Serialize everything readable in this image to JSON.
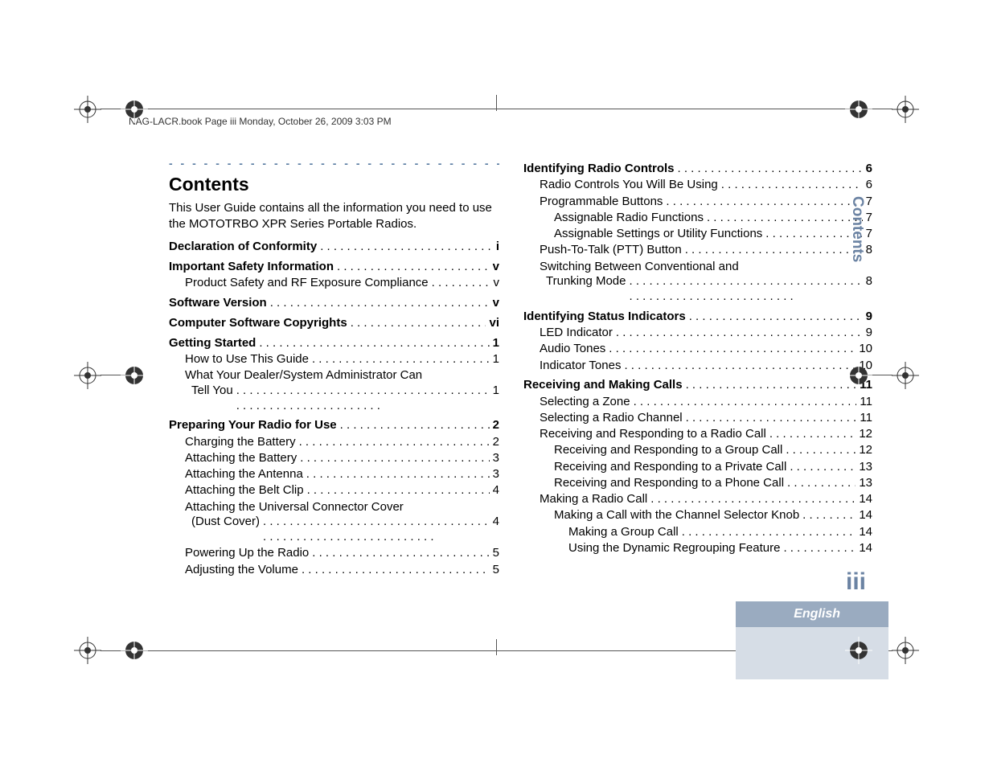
{
  "header_line": "NAG-LACR.book  Page iii  Monday, October 26, 2009  3:03 PM",
  "title": "Contents",
  "intro": "This User Guide contains all the information you need to use the MOTOTRBO XPR Series Portable Radios.",
  "sidebar_tab": "Contents",
  "page_number": "iii",
  "language_tab": "English",
  "left_toc": [
    {
      "type": "sec",
      "label": "Declaration of Conformity",
      "page": "i"
    },
    {
      "type": "sec",
      "label": "Important Safety Information",
      "page": "v"
    },
    {
      "type": "sub1",
      "label": "Product Safety and RF Exposure Compliance",
      "page": "v"
    },
    {
      "type": "sec",
      "label": "Software Version",
      "page": "v"
    },
    {
      "type": "sec",
      "label": "Computer Software Copyrights",
      "page": "vi"
    },
    {
      "type": "sec",
      "label": "Getting Started",
      "page": "1"
    },
    {
      "type": "sub1",
      "label": "How to Use This Guide",
      "page": "1"
    },
    {
      "type": "wrap1",
      "first": "What Your Dealer/System Administrator Can",
      "last": "Tell You",
      "page": "1"
    },
    {
      "type": "sec",
      "label": "Preparing Your Radio for Use",
      "page": "2"
    },
    {
      "type": "sub1",
      "label": "Charging the Battery",
      "page": "2"
    },
    {
      "type": "sub1",
      "label": "Attaching the Battery",
      "page": "3"
    },
    {
      "type": "sub1",
      "label": "Attaching the Antenna",
      "page": "3"
    },
    {
      "type": "sub1",
      "label": "Attaching the Belt Clip",
      "page": "4"
    },
    {
      "type": "wrap1",
      "first": "Attaching the Universal Connector Cover",
      "last": "(Dust Cover)",
      "page": "4"
    },
    {
      "type": "sub1",
      "label": "Powering Up the Radio",
      "page": "5"
    },
    {
      "type": "sub1",
      "label": "Adjusting the Volume",
      "page": "5"
    }
  ],
  "right_toc": [
    {
      "type": "sec",
      "label": "Identifying Radio Controls",
      "page": "6"
    },
    {
      "type": "sub1",
      "label": "Radio Controls You Will Be Using",
      "page": "6"
    },
    {
      "type": "sub1",
      "label": "Programmable Buttons",
      "page": "7"
    },
    {
      "type": "sub2",
      "label": "Assignable Radio Functions",
      "page": "7"
    },
    {
      "type": "sub2",
      "label": "Assignable Settings or Utility Functions",
      "page": "7"
    },
    {
      "type": "sub1",
      "label": "Push-To-Talk (PTT) Button",
      "page": "8"
    },
    {
      "type": "wrap1",
      "first": "Switching Between Conventional and",
      "last": "Trunking Mode",
      "page": "8"
    },
    {
      "type": "sec",
      "label": "Identifying Status Indicators",
      "page": "9"
    },
    {
      "type": "sub1",
      "label": "LED Indicator",
      "page": "9"
    },
    {
      "type": "sub1",
      "label": "Audio Tones",
      "page": "10"
    },
    {
      "type": "sub1",
      "label": "Indicator Tones",
      "page": "10"
    },
    {
      "type": "sec",
      "label": "Receiving and Making Calls",
      "page": "11"
    },
    {
      "type": "sub1",
      "label": "Selecting a Zone",
      "page": "11"
    },
    {
      "type": "sub1",
      "label": "Selecting a Radio Channel",
      "page": "11"
    },
    {
      "type": "sub1",
      "label": "Receiving and Responding to a Radio Call",
      "page": "12"
    },
    {
      "type": "sub2",
      "label": "Receiving and Responding to a Group Call",
      "page": "12"
    },
    {
      "type": "sub2",
      "label": "Receiving and Responding to a Private Call",
      "page": "13"
    },
    {
      "type": "sub2",
      "label": "Receiving and Responding to a Phone Call",
      "page": "13"
    },
    {
      "type": "sub1",
      "label": "Making a Radio Call",
      "page": "14"
    },
    {
      "type": "sub2",
      "label": "Making a Call with the Channel Selector Knob",
      "page": "14"
    },
    {
      "type": "sub3",
      "label": "Making a Group Call",
      "page": "14"
    },
    {
      "type": "sub3",
      "label": "Using the Dynamic Regrouping Feature",
      "page": "14"
    }
  ]
}
